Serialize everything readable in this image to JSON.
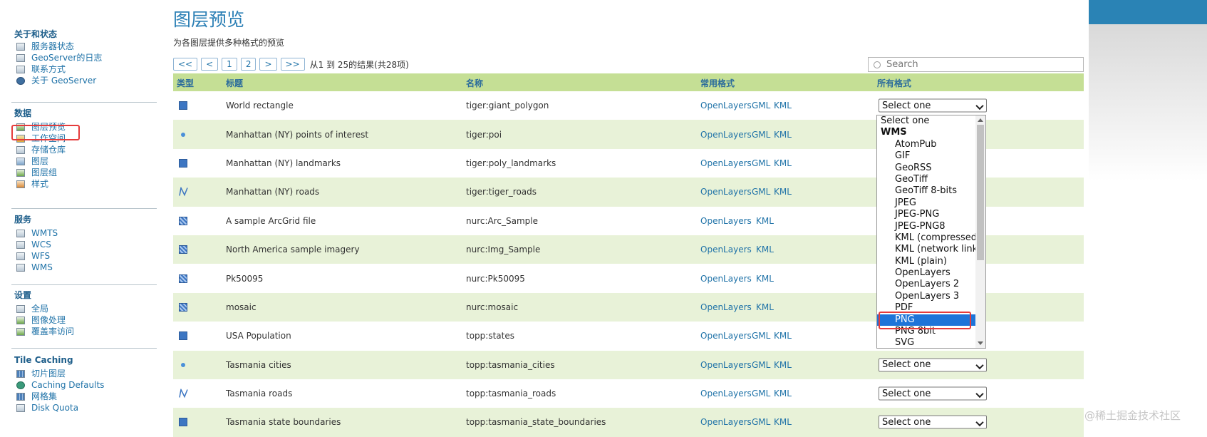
{
  "sidebar": {
    "sections": [
      {
        "title": "关于和状态",
        "items": [
          {
            "label": "服务器状态",
            "icon": "server-status-icon"
          },
          {
            "label": "GeoServer的日志",
            "icon": "log-icon"
          },
          {
            "label": "联系方式",
            "icon": "contact-icon"
          },
          {
            "label": "关于 GeoServer",
            "icon": "about-icon"
          }
        ]
      },
      {
        "title": "数据",
        "items": [
          {
            "label": "图层预览",
            "icon": "layer-preview-icon"
          },
          {
            "label": "工作空间",
            "icon": "workspace-icon"
          },
          {
            "label": "存储仓库",
            "icon": "store-icon"
          },
          {
            "label": "图层",
            "icon": "layers-icon"
          },
          {
            "label": "图层组",
            "icon": "layer-group-icon"
          },
          {
            "label": "样式",
            "icon": "style-icon"
          }
        ]
      },
      {
        "title": "服务",
        "items": [
          {
            "label": "WMTS",
            "icon": "wmts-icon"
          },
          {
            "label": "WCS",
            "icon": "wcs-icon"
          },
          {
            "label": "WFS",
            "icon": "wfs-icon"
          },
          {
            "label": "WMS",
            "icon": "wms-icon"
          }
        ]
      },
      {
        "title": "设置",
        "items": [
          {
            "label": "全局",
            "icon": "global-icon"
          },
          {
            "label": "图像处理",
            "icon": "image-processing-icon"
          },
          {
            "label": "覆盖率访问",
            "icon": "coverage-access-icon"
          }
        ]
      },
      {
        "title": "Tile Caching",
        "items": [
          {
            "label": "切片图层",
            "icon": "tile-layers-icon"
          },
          {
            "label": "Caching Defaults",
            "icon": "caching-defaults-icon"
          },
          {
            "label": "网格集",
            "icon": "gridsets-icon"
          },
          {
            "label": "Disk Quota",
            "icon": "disk-quota-icon"
          }
        ]
      }
    ]
  },
  "page": {
    "title": "图层预览",
    "subtitle": "为各图层提供多种格式的预览"
  },
  "pager": {
    "buttons": [
      "<<",
      "<",
      "1",
      "2",
      ">",
      ">>"
    ],
    "info": "从1 到 25的结果(共28项)"
  },
  "search": {
    "placeholder": "Search"
  },
  "table": {
    "headers": {
      "type": "类型",
      "title": "标题",
      "name": "名称",
      "common": "常用格式",
      "all": "所有格式"
    },
    "rows": [
      {
        "type": "polygon",
        "title": "World rectangle",
        "name": "tiger:giant_polygon",
        "formats": [
          "OpenLayers",
          "GML",
          "KML"
        ],
        "select": "Select one"
      },
      {
        "type": "point",
        "title": "Manhattan (NY) points of interest",
        "name": "tiger:poi",
        "formats": [
          "OpenLayers",
          "GML",
          "KML"
        ],
        "select": ""
      },
      {
        "type": "polygon",
        "title": "Manhattan (NY) landmarks",
        "name": "tiger:poly_landmarks",
        "formats": [
          "OpenLayers",
          "GML",
          "KML"
        ],
        "select": ""
      },
      {
        "type": "line",
        "title": "Manhattan (NY) roads",
        "name": "tiger:tiger_roads",
        "formats": [
          "OpenLayers",
          "GML",
          "KML"
        ],
        "select": ""
      },
      {
        "type": "raster",
        "title": "A sample ArcGrid file",
        "name": "nurc:Arc_Sample",
        "formats": [
          "OpenLayers",
          "KML"
        ],
        "select": ""
      },
      {
        "type": "raster",
        "title": "North America sample imagery",
        "name": "nurc:Img_Sample",
        "formats": [
          "OpenLayers",
          "KML"
        ],
        "select": ""
      },
      {
        "type": "raster",
        "title": "Pk50095",
        "name": "nurc:Pk50095",
        "formats": [
          "OpenLayers",
          "KML"
        ],
        "select": ""
      },
      {
        "type": "raster",
        "title": "mosaic",
        "name": "nurc:mosaic",
        "formats": [
          "OpenLayers",
          "KML"
        ],
        "select": ""
      },
      {
        "type": "polygon",
        "title": "USA Population",
        "name": "topp:states",
        "formats": [
          "OpenLayers",
          "GML",
          "KML"
        ],
        "select": ""
      },
      {
        "type": "point",
        "title": "Tasmania cities",
        "name": "topp:tasmania_cities",
        "formats": [
          "OpenLayers",
          "GML",
          "KML"
        ],
        "select": "Select one"
      },
      {
        "type": "line",
        "title": "Tasmania roads",
        "name": "topp:tasmania_roads",
        "formats": [
          "OpenLayers",
          "GML",
          "KML"
        ],
        "select": "Select one"
      },
      {
        "type": "polygon",
        "title": "Tasmania state boundaries",
        "name": "topp:tasmania_state_boundaries",
        "formats": [
          "OpenLayers",
          "GML",
          "KML"
        ],
        "select": "Select one"
      }
    ]
  },
  "dropdown": {
    "items": [
      {
        "label": "Select one",
        "kind": "first"
      },
      {
        "label": "WMS",
        "kind": "group"
      },
      {
        "label": "AtomPub",
        "kind": "opt"
      },
      {
        "label": "GIF",
        "kind": "opt"
      },
      {
        "label": "GeoRSS",
        "kind": "opt"
      },
      {
        "label": "GeoTiff",
        "kind": "opt"
      },
      {
        "label": "GeoTiff 8-bits",
        "kind": "opt"
      },
      {
        "label": "JPEG",
        "kind": "opt"
      },
      {
        "label": "JPEG-PNG",
        "kind": "opt"
      },
      {
        "label": "JPEG-PNG8",
        "kind": "opt"
      },
      {
        "label": "KML (compressed)",
        "kind": "opt"
      },
      {
        "label": "KML (network link)",
        "kind": "opt"
      },
      {
        "label": "KML (plain)",
        "kind": "opt"
      },
      {
        "label": "OpenLayers",
        "kind": "opt"
      },
      {
        "label": "OpenLayers 2",
        "kind": "opt"
      },
      {
        "label": "OpenLayers 3",
        "kind": "opt"
      },
      {
        "label": "PDF",
        "kind": "opt"
      },
      {
        "label": "PNG",
        "kind": "opt",
        "highlighted": true
      },
      {
        "label": "PNG 8bit",
        "kind": "opt"
      },
      {
        "label": "SVG",
        "kind": "opt"
      }
    ]
  },
  "watermark": "@稀土掘金技术社区",
  "colors": {
    "accent": "#2b7fb5",
    "header_bg": "#c5df95",
    "row_alt": "#e8f2d8",
    "highlight": "#e53b3b",
    "selection": "#1e74d8"
  }
}
